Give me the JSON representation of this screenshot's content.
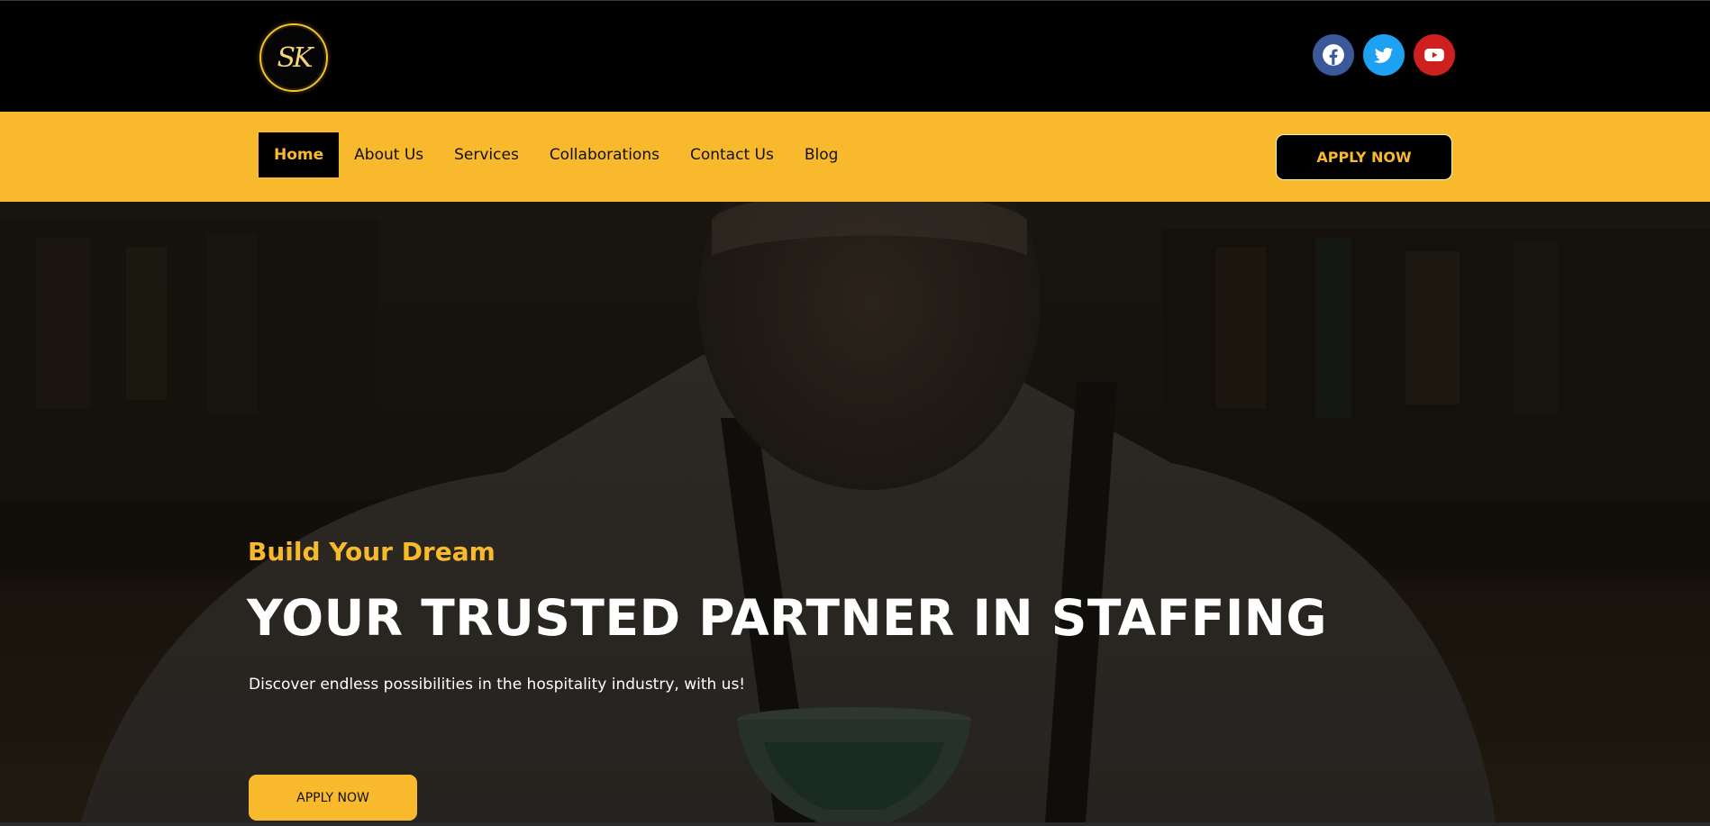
{
  "header": {
    "logo_text": "SK",
    "social": [
      {
        "name": "facebook-icon",
        "color": "#3b5998"
      },
      {
        "name": "twitter-icon",
        "color": "#1da1f2"
      },
      {
        "name": "youtube-icon",
        "color": "#cd201f"
      }
    ]
  },
  "nav": {
    "items": [
      {
        "label": "Home",
        "active": true
      },
      {
        "label": "About Us"
      },
      {
        "label": "Services"
      },
      {
        "label": "Collaborations"
      },
      {
        "label": "Contact Us"
      },
      {
        "label": "Blog"
      }
    ],
    "apply_label": "APPLY NOW"
  },
  "hero": {
    "tagline": "Build Your Dream",
    "headline": "YOUR TRUSTED PARTNER IN STAFFING",
    "subtext": "Discover endless possibilities in the hospitality industry, with us!",
    "apply_label": "APPLY NOW"
  },
  "colors": {
    "accent": "#f9b92c",
    "topbar": "#000000"
  }
}
